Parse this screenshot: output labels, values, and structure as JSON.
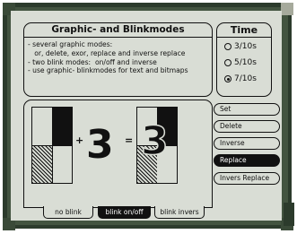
{
  "header": {
    "title": "Graphic- and Blinkmodes"
  },
  "description": {
    "lines": [
      "- several graphic modes:",
      "   or, delete, exor, replace and inverse replace",
      "- two blink modes:  on/off and inverse",
      "- use graphic- blinkmodes for text and bitmaps"
    ]
  },
  "time": {
    "title": "Time",
    "options": [
      "3/10s",
      "5/10s",
      "7/10s"
    ],
    "selected": "7/10s"
  },
  "demo": {
    "plus": "+",
    "equals": "=",
    "digit_left": "3",
    "digit_right": "3"
  },
  "modes": {
    "items": [
      "Set",
      "Delete",
      "Inverse",
      "Replace",
      "Invers Replace"
    ],
    "selected": "Replace"
  },
  "blink": {
    "tabs": [
      "no blink",
      "blink on/off",
      "blink invers"
    ],
    "selected": "blink on/off"
  },
  "colors": {
    "bezel": "#2c3b2c",
    "screen": "#d9ddd5",
    "ink": "#111111"
  }
}
